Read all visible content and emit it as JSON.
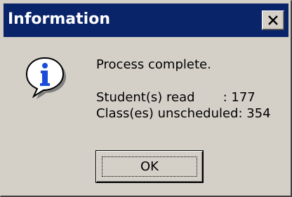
{
  "window": {
    "title": "Information",
    "close_icon": "close-icon"
  },
  "message": {
    "icon": "info-icon",
    "line1": "Process complete.",
    "line2": "Student(s) read       : 177",
    "line3": "Class(es) unscheduled: 354"
  },
  "buttons": {
    "ok_label": "OK"
  },
  "colors": {
    "titlebar": "#0a246a",
    "dialog_bg": "#d4d0c8",
    "icon_blue": "#1a4cd8"
  }
}
